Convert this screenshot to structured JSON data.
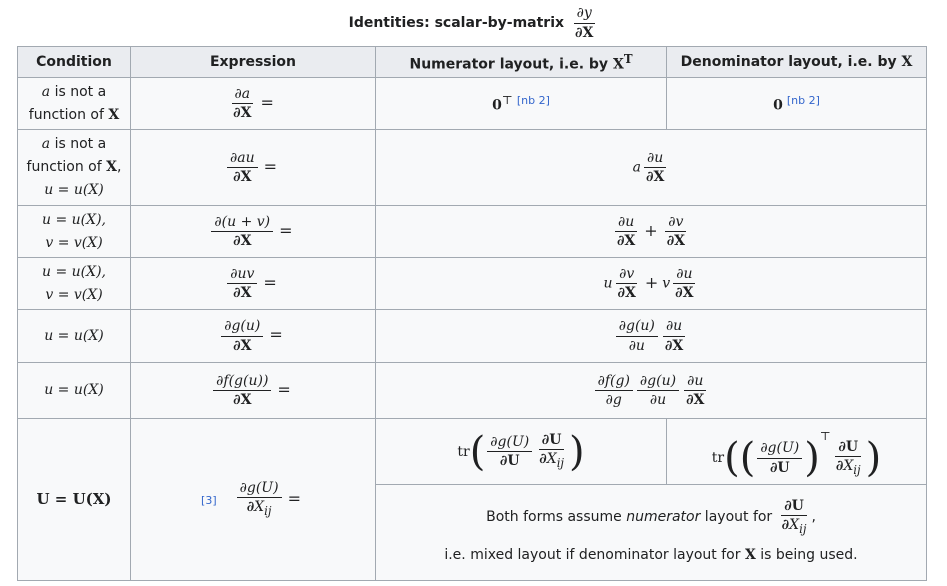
{
  "caption": {
    "text": "Identities: scalar-by-matrix",
    "num": "∂y",
    "den": "∂X"
  },
  "headers": {
    "condition": "Condition",
    "expression": "Expression",
    "numerator": "Numerator layout, i.e. by ",
    "numerator_sym": "X",
    "numerator_sup": "T",
    "denominator": "Denominator layout, i.e. by ",
    "denominator_sym": "X"
  },
  "rows": [
    {
      "cond_parts": [
        "a",
        " is not a",
        "function of ",
        "X"
      ],
      "expr_num": "∂a",
      "expr_den": "∂X",
      "num_result": "0",
      "num_sup": "⊤",
      "num_ref": "[nb 2]",
      "den_result": "0",
      "den_ref": "[nb 2]"
    },
    {
      "cond_parts": [
        "a",
        " is not a",
        "function of ",
        "X",
        ",",
        "u = u(X)"
      ],
      "expr_num": "∂au",
      "expr_den": "∂X",
      "res_pre": "a",
      "res_num": "∂u",
      "res_den": "∂X"
    },
    {
      "cond_lines": [
        "u = u(X),",
        "v = v(X)"
      ],
      "expr_num": "∂(u + v)",
      "expr_den": "∂X",
      "res": [
        {
          "num": "∂u",
          "den": "∂X"
        },
        {
          "op": "+"
        },
        {
          "num": "∂v",
          "den": "∂X"
        }
      ]
    },
    {
      "cond_lines": [
        "u = u(X),",
        "v = v(X)"
      ],
      "expr_num": "∂uv",
      "expr_den": "∂X",
      "res_a": "u",
      "res_a_num": "∂v",
      "res_a_den": "∂X",
      "res_op": "+",
      "res_b": "v",
      "res_b_num": "∂u",
      "res_b_den": "∂X"
    },
    {
      "cond_lines": [
        "u = u(X)"
      ],
      "expr_num": "∂g(u)",
      "expr_den": "∂X",
      "res": [
        {
          "num": "∂g(u)",
          "den": "∂u"
        },
        {
          "num": "∂u",
          "den": "∂X"
        }
      ]
    },
    {
      "cond_lines": [
        "u = u(X)"
      ],
      "expr_num": "∂f(g(u))",
      "expr_den": "∂X",
      "res": [
        {
          "num": "∂f(g)",
          "den": "∂g"
        },
        {
          "num": "∂g(u)",
          "den": "∂u"
        },
        {
          "num": "∂u",
          "den": "∂X"
        }
      ]
    },
    {
      "cond": "U = U(X)",
      "expr_ref": "[3]",
      "expr_num": "∂g(U)",
      "expr_den": "∂X",
      "expr_den_sub": "ij",
      "num_tr": "tr",
      "num_f1_num": "∂g(U)",
      "num_f1_den": "∂U",
      "num_f2_num": "∂U",
      "num_f2_den": "∂X",
      "num_f2_sub": "ij",
      "den_tr": "tr",
      "den_sup": "⊤",
      "den_f1_num": "∂g(U)",
      "den_f1_den": "∂U",
      "den_f2_num": "∂U",
      "den_f2_den": "∂X",
      "den_f2_sub": "ij",
      "note_pre": "Both forms assume ",
      "note_em": "numerator",
      "note_post": " layout for",
      "note_num": "∂U",
      "note_den": "∂X",
      "note_sub": "ij",
      "note_comma": ",",
      "note2_pre": "i.e. mixed layout if denominator layout for ",
      "note2_sym": "X",
      "note2_post": " is being used."
    }
  ],
  "eq": "="
}
